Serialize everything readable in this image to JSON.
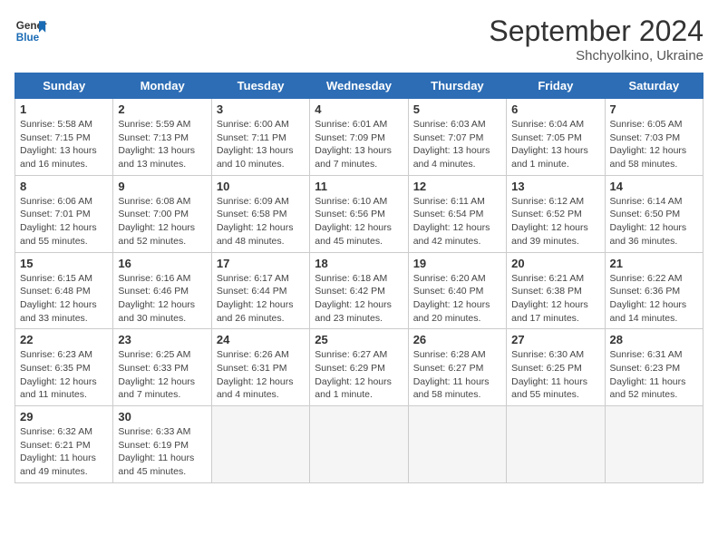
{
  "header": {
    "logo_line1": "General",
    "logo_line2": "Blue",
    "month_title": "September 2024",
    "location": "Shchyolkino, Ukraine"
  },
  "weekdays": [
    "Sunday",
    "Monday",
    "Tuesday",
    "Wednesday",
    "Thursday",
    "Friday",
    "Saturday"
  ],
  "weeks": [
    [
      {
        "day": "1",
        "detail": "Sunrise: 5:58 AM\nSunset: 7:15 PM\nDaylight: 13 hours\nand 16 minutes."
      },
      {
        "day": "2",
        "detail": "Sunrise: 5:59 AM\nSunset: 7:13 PM\nDaylight: 13 hours\nand 13 minutes."
      },
      {
        "day": "3",
        "detail": "Sunrise: 6:00 AM\nSunset: 7:11 PM\nDaylight: 13 hours\nand 10 minutes."
      },
      {
        "day": "4",
        "detail": "Sunrise: 6:01 AM\nSunset: 7:09 PM\nDaylight: 13 hours\nand 7 minutes."
      },
      {
        "day": "5",
        "detail": "Sunrise: 6:03 AM\nSunset: 7:07 PM\nDaylight: 13 hours\nand 4 minutes."
      },
      {
        "day": "6",
        "detail": "Sunrise: 6:04 AM\nSunset: 7:05 PM\nDaylight: 13 hours\nand 1 minute."
      },
      {
        "day": "7",
        "detail": "Sunrise: 6:05 AM\nSunset: 7:03 PM\nDaylight: 12 hours\nand 58 minutes."
      }
    ],
    [
      {
        "day": "8",
        "detail": "Sunrise: 6:06 AM\nSunset: 7:01 PM\nDaylight: 12 hours\nand 55 minutes."
      },
      {
        "day": "9",
        "detail": "Sunrise: 6:08 AM\nSunset: 7:00 PM\nDaylight: 12 hours\nand 52 minutes."
      },
      {
        "day": "10",
        "detail": "Sunrise: 6:09 AM\nSunset: 6:58 PM\nDaylight: 12 hours\nand 48 minutes."
      },
      {
        "day": "11",
        "detail": "Sunrise: 6:10 AM\nSunset: 6:56 PM\nDaylight: 12 hours\nand 45 minutes."
      },
      {
        "day": "12",
        "detail": "Sunrise: 6:11 AM\nSunset: 6:54 PM\nDaylight: 12 hours\nand 42 minutes."
      },
      {
        "day": "13",
        "detail": "Sunrise: 6:12 AM\nSunset: 6:52 PM\nDaylight: 12 hours\nand 39 minutes."
      },
      {
        "day": "14",
        "detail": "Sunrise: 6:14 AM\nSunset: 6:50 PM\nDaylight: 12 hours\nand 36 minutes."
      }
    ],
    [
      {
        "day": "15",
        "detail": "Sunrise: 6:15 AM\nSunset: 6:48 PM\nDaylight: 12 hours\nand 33 minutes."
      },
      {
        "day": "16",
        "detail": "Sunrise: 6:16 AM\nSunset: 6:46 PM\nDaylight: 12 hours\nand 30 minutes."
      },
      {
        "day": "17",
        "detail": "Sunrise: 6:17 AM\nSunset: 6:44 PM\nDaylight: 12 hours\nand 26 minutes."
      },
      {
        "day": "18",
        "detail": "Sunrise: 6:18 AM\nSunset: 6:42 PM\nDaylight: 12 hours\nand 23 minutes."
      },
      {
        "day": "19",
        "detail": "Sunrise: 6:20 AM\nSunset: 6:40 PM\nDaylight: 12 hours\nand 20 minutes."
      },
      {
        "day": "20",
        "detail": "Sunrise: 6:21 AM\nSunset: 6:38 PM\nDaylight: 12 hours\nand 17 minutes."
      },
      {
        "day": "21",
        "detail": "Sunrise: 6:22 AM\nSunset: 6:36 PM\nDaylight: 12 hours\nand 14 minutes."
      }
    ],
    [
      {
        "day": "22",
        "detail": "Sunrise: 6:23 AM\nSunset: 6:35 PM\nDaylight: 12 hours\nand 11 minutes."
      },
      {
        "day": "23",
        "detail": "Sunrise: 6:25 AM\nSunset: 6:33 PM\nDaylight: 12 hours\nand 7 minutes."
      },
      {
        "day": "24",
        "detail": "Sunrise: 6:26 AM\nSunset: 6:31 PM\nDaylight: 12 hours\nand 4 minutes."
      },
      {
        "day": "25",
        "detail": "Sunrise: 6:27 AM\nSunset: 6:29 PM\nDaylight: 12 hours\nand 1 minute."
      },
      {
        "day": "26",
        "detail": "Sunrise: 6:28 AM\nSunset: 6:27 PM\nDaylight: 11 hours\nand 58 minutes."
      },
      {
        "day": "27",
        "detail": "Sunrise: 6:30 AM\nSunset: 6:25 PM\nDaylight: 11 hours\nand 55 minutes."
      },
      {
        "day": "28",
        "detail": "Sunrise: 6:31 AM\nSunset: 6:23 PM\nDaylight: 11 hours\nand 52 minutes."
      }
    ],
    [
      {
        "day": "29",
        "detail": "Sunrise: 6:32 AM\nSunset: 6:21 PM\nDaylight: 11 hours\nand 49 minutes."
      },
      {
        "day": "30",
        "detail": "Sunrise: 6:33 AM\nSunset: 6:19 PM\nDaylight: 11 hours\nand 45 minutes."
      },
      {
        "day": "",
        "detail": ""
      },
      {
        "day": "",
        "detail": ""
      },
      {
        "day": "",
        "detail": ""
      },
      {
        "day": "",
        "detail": ""
      },
      {
        "day": "",
        "detail": ""
      }
    ]
  ]
}
